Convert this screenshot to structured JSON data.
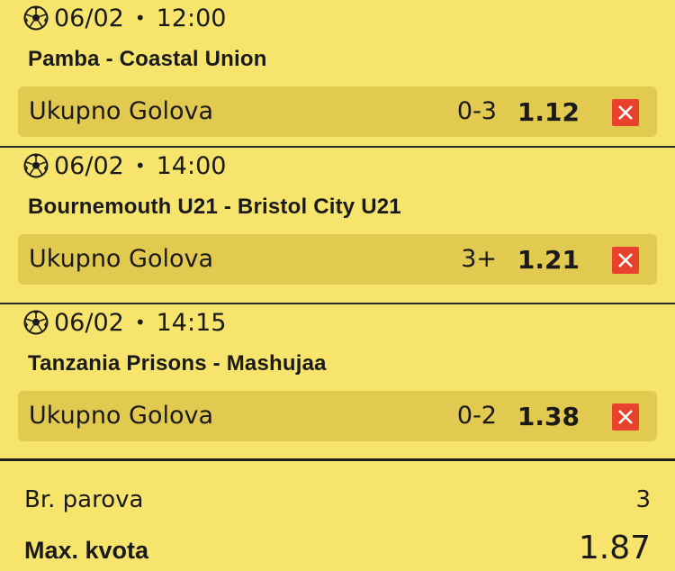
{
  "bets": [
    {
      "date": "06/02",
      "time": "12:00",
      "match": "Pamba - Coastal Union",
      "market": "Ukupno Golova",
      "pick": "0-3",
      "odd": "1.12"
    },
    {
      "date": "06/02",
      "time": "14:00",
      "match": "Bournemouth U21 - Bristol City U21",
      "market": "Ukupno Golova",
      "pick": "3+",
      "odd": "1.21"
    },
    {
      "date": "06/02",
      "time": "14:15",
      "match": "Tanzania Prisons - Mashujaa",
      "market": "Ukupno Golova",
      "pick": "0-2",
      "odd": "1.38"
    }
  ],
  "summary": {
    "pairs_label": "Br. parova",
    "pairs_value": "3",
    "max_odd_label": "Max. kvota",
    "max_odd_value": "1.87"
  },
  "separator": "•",
  "icons": {
    "sport": "soccer-ball-icon",
    "remove": "close-icon"
  },
  "colors": {
    "background": "#f7e46c",
    "market_row": "#e2ca51",
    "remove_button": "#e8412d"
  }
}
